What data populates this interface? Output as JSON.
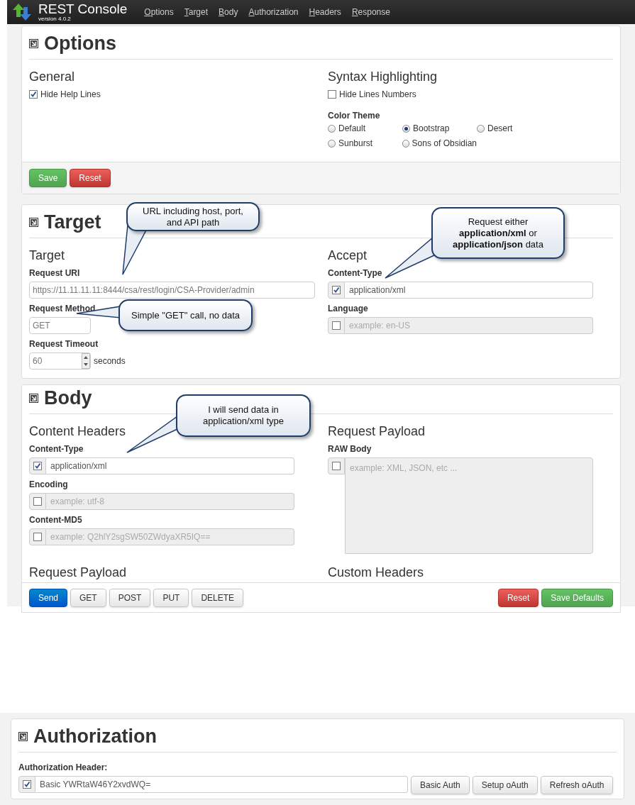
{
  "app": {
    "title": "REST Console",
    "version": "version 4.0.2"
  },
  "nav": [
    {
      "label": "Options"
    },
    {
      "label": "Target"
    },
    {
      "label": "Body"
    },
    {
      "label": "Authorization"
    },
    {
      "label": "Headers"
    },
    {
      "label": "Response"
    }
  ],
  "options": {
    "title": "Options",
    "general": {
      "heading": "General",
      "checks": [
        {
          "label": "Hide Help Lines",
          "checked": true
        }
      ]
    },
    "syntax": {
      "heading": "Syntax Highlighting",
      "checks": [
        {
          "label": "Hide Lines Numbers",
          "checked": false
        }
      ],
      "theme_label": "Color Theme",
      "themes": [
        {
          "label": "Default",
          "selected": false
        },
        {
          "label": "Bootstrap",
          "selected": true
        },
        {
          "label": "Desert",
          "selected": false
        },
        {
          "label": "Sunburst",
          "selected": false
        },
        {
          "label": "Sons of Obsidian",
          "selected": false
        }
      ]
    },
    "buttons": [
      {
        "label": "Save",
        "kind": "success"
      },
      {
        "label": "Reset",
        "kind": "danger"
      }
    ]
  },
  "target": {
    "title": "Target",
    "left_heading": "Target",
    "uri": {
      "label": "Request URI",
      "value": "https://11.11.11.11:8444/csa/rest/login/CSA-Provider/admin"
    },
    "method": {
      "label": "Request Method",
      "value": "GET"
    },
    "timeout": {
      "label": "Request Timeout",
      "value": "60",
      "unit": "seconds"
    },
    "right_heading": "Accept",
    "fields": [
      {
        "label": "Content-Type",
        "checked": true,
        "value": "application/xml"
      },
      {
        "label": "Language",
        "checked": false,
        "placeholder": "example: en-US"
      }
    ]
  },
  "body": {
    "title": "Body",
    "left_heading": "Content Headers",
    "fields": [
      {
        "label": "Content-Type",
        "checked": true,
        "value": "application/xml"
      },
      {
        "label": "Encoding",
        "checked": false,
        "placeholder": "example: utf-8"
      },
      {
        "label": "Content-MD5",
        "checked": false,
        "placeholder": "example: Q2hlY2sgSW50ZWdyaXR5IQ=="
      }
    ],
    "right_heading": "Request Payload",
    "raw": {
      "label": "RAW Body",
      "checked": false,
      "placeholder": "example: XML, JSON, etc ..."
    },
    "lower_left_heading": "Request Payload",
    "lower_right_heading": "Custom Headers"
  },
  "action_bar": {
    "left": [
      {
        "label": "Send",
        "kind": "primary"
      },
      {
        "label": "GET",
        "kind": "default"
      },
      {
        "label": "POST",
        "kind": "default"
      },
      {
        "label": "PUT",
        "kind": "default"
      },
      {
        "label": "DELETE",
        "kind": "default"
      }
    ],
    "right": [
      {
        "label": "Reset",
        "kind": "danger"
      },
      {
        "label": "Save Defaults",
        "kind": "success"
      }
    ]
  },
  "authorization": {
    "title": "Authorization",
    "label": "Authorization Header:",
    "field": {
      "checked": true,
      "value": "Basic YWRtaW46Y2xvdWQ="
    },
    "buttons": [
      {
        "label": "Basic Auth"
      },
      {
        "label": "Setup oAuth"
      },
      {
        "label": "Refresh oAuth"
      }
    ]
  },
  "callouts": [
    {
      "text": "URL including host, port, and API path"
    },
    {
      "text": "Request either **application/xml** or **application/json** data"
    },
    {
      "text": "Simple \"GET\" call, no data"
    },
    {
      "text": "I will send data in application/xml type"
    }
  ]
}
